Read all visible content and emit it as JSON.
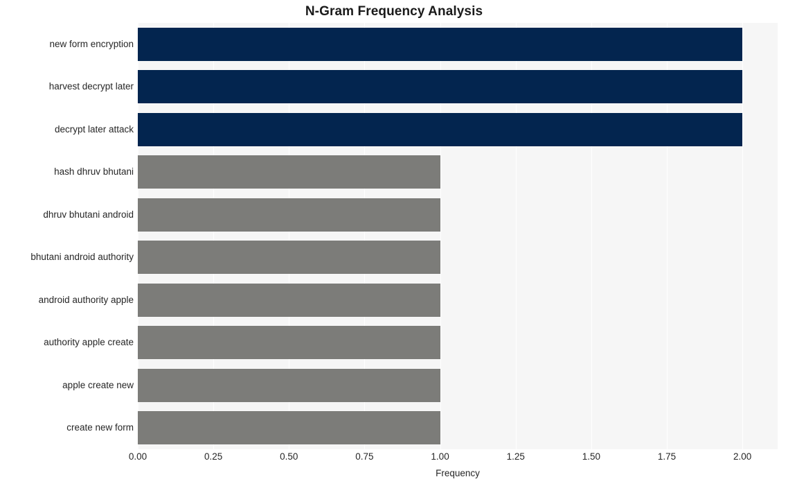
{
  "chart_data": {
    "type": "bar",
    "orientation": "horizontal",
    "title": "N-Gram Frequency Analysis",
    "xlabel": "Frequency",
    "ylabel": "",
    "categories": [
      "new form encryption",
      "harvest decrypt later",
      "decrypt later attack",
      "hash dhruv bhutani",
      "dhruv bhutani android",
      "bhutani android authority",
      "android authority apple",
      "authority apple create",
      "apple create new",
      "create new form"
    ],
    "values": [
      2,
      2,
      2,
      1,
      1,
      1,
      1,
      1,
      1,
      1
    ],
    "bar_colors": [
      "#03254f",
      "#03254f",
      "#03254f",
      "#7c7c79",
      "#7c7c79",
      "#7c7c79",
      "#7c7c79",
      "#7c7c79",
      "#7c7c79",
      "#7c7c79"
    ],
    "xlim": [
      0.0,
      2.1165
    ],
    "xticks": [
      0.0,
      0.25,
      0.5,
      0.75,
      1.0,
      1.25,
      1.5,
      1.75,
      2.0
    ],
    "xtick_labels": [
      "0.00",
      "0.25",
      "0.50",
      "0.75",
      "1.00",
      "1.25",
      "1.50",
      "1.75",
      "2.00"
    ],
    "grid": true,
    "grid_axis": "x",
    "grid_color": "#ffffff",
    "plot_background": "#f6f6f6",
    "figure_background": "#ffffff",
    "legend": null
  }
}
